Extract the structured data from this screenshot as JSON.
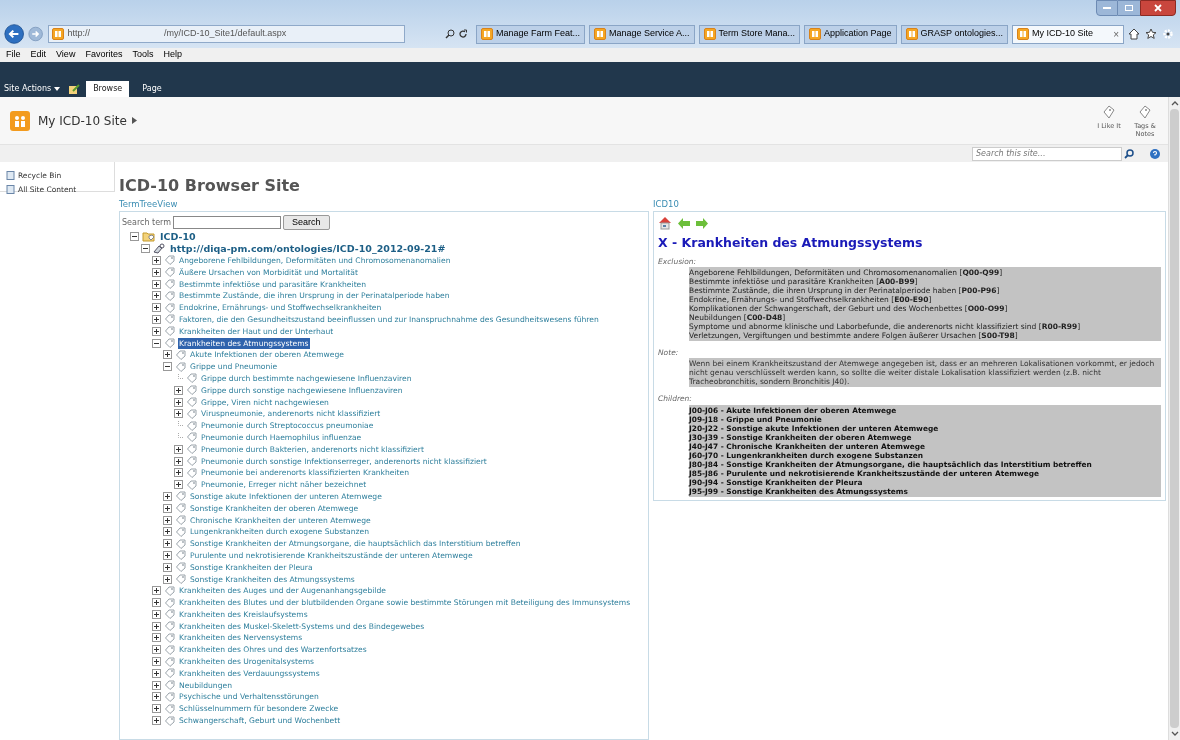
{
  "browser": {
    "address": {
      "scheme": "http://",
      "path": "/my/ICD-10_Site1/default.aspx"
    },
    "tabs": [
      {
        "label": "Manage Farm Feat...",
        "selected": false
      },
      {
        "label": "Manage Service A...",
        "selected": false
      },
      {
        "label": "Term Store Mana...",
        "selected": false
      },
      {
        "label": "Application Page",
        "selected": false
      },
      {
        "label": "GRASP ontologies...",
        "selected": false
      },
      {
        "label": "My ICD-10 Site",
        "selected": true
      }
    ],
    "close_tab": "×",
    "menu": [
      "File",
      "Edit",
      "View",
      "Favorites",
      "Tools",
      "Help"
    ]
  },
  "ribbon": {
    "site_actions": "Site Actions",
    "tabs": [
      {
        "label": "Browse",
        "selected": true
      },
      {
        "label": "Page",
        "selected": false
      }
    ],
    "breadcrumb": "My ICD-10 Site",
    "actions": [
      "I Like It",
      "Tags & Notes"
    ],
    "search": {
      "placeholder": "Search this site..."
    }
  },
  "left_nav": [
    "Recycle Bin",
    "All Site Content"
  ],
  "page_title": "ICD-10 Browser Site",
  "tree_panel": {
    "title": "TermTreeView",
    "search_label": "Search term",
    "search_button": "Search",
    "tree": [
      {
        "label": "ICD-10",
        "kind": "root",
        "expanded": true,
        "leaf": false,
        "selected": false,
        "children": [
          {
            "label": "http://diqa-pm.com/ontologies/ICD-10_2012-09-21#",
            "kind": "ontology",
            "expanded": true,
            "leaf": false,
            "selected": false,
            "children": [
              {
                "label": "Angeborene Fehlbildungen, Deformitäten und Chromosomenanomalien",
                "kind": "term",
                "expanded": false,
                "leaf": false,
                "selected": false
              },
              {
                "label": "Äußere Ursachen von Morbidität und Mortalität",
                "kind": "term",
                "expanded": false,
                "leaf": false,
                "selected": false
              },
              {
                "label": "Bestimmte infektiöse und parasitäre Krankheiten",
                "kind": "term",
                "expanded": false,
                "leaf": false,
                "selected": false
              },
              {
                "label": "Bestimmte Zustände, die ihren Ursprung in der Perinatalperiode haben",
                "kind": "term",
                "expanded": false,
                "leaf": false,
                "selected": false
              },
              {
                "label": "Endokrine, Ernährungs- und Stoffwechselkrankheiten",
                "kind": "term",
                "expanded": false,
                "leaf": false,
                "selected": false
              },
              {
                "label": "Faktoren, die den Gesundheitszustand beeinflussen und zur Inanspruchnahme des Gesundheitswesens führen",
                "kind": "term",
                "expanded": false,
                "leaf": false,
                "selected": false
              },
              {
                "label": "Krankheiten der Haut und der Unterhaut",
                "kind": "term",
                "expanded": false,
                "leaf": false,
                "selected": false
              },
              {
                "label": "Krankheiten des Atmungssystems",
                "kind": "term",
                "expanded": true,
                "leaf": false,
                "selected": true,
                "children": [
                  {
                    "label": "Akute Infektionen der oberen Atemwege",
                    "kind": "term",
                    "expanded": false,
                    "leaf": false,
                    "selected": false
                  },
                  {
                    "label": "Grippe und Pneumonie",
                    "kind": "term",
                    "expanded": true,
                    "leaf": false,
                    "selected": false,
                    "children": [
                      {
                        "label": "Grippe durch bestimmte nachgewiesene Influenzaviren",
                        "kind": "term",
                        "expanded": false,
                        "leaf": true,
                        "selected": false
                      },
                      {
                        "label": "Grippe durch sonstige nachgewiesene Influenzaviren",
                        "kind": "term",
                        "expanded": false,
                        "leaf": false,
                        "selected": false
                      },
                      {
                        "label": "Grippe, Viren nicht nachgewiesen",
                        "kind": "term",
                        "expanded": false,
                        "leaf": false,
                        "selected": false
                      },
                      {
                        "label": "Viruspneumonie, anderenorts nicht klassifiziert",
                        "kind": "term",
                        "expanded": false,
                        "leaf": false,
                        "selected": false
                      },
                      {
                        "label": "Pneumonie durch Streptococcus pneumoniae",
                        "kind": "term",
                        "expanded": false,
                        "leaf": true,
                        "selected": false
                      },
                      {
                        "label": "Pneumonie durch Haemophilus influenzae",
                        "kind": "term",
                        "expanded": false,
                        "leaf": true,
                        "selected": false
                      },
                      {
                        "label": "Pneumonie durch Bakterien, anderenorts nicht klassifiziert",
                        "kind": "term",
                        "expanded": false,
                        "leaf": false,
                        "selected": false
                      },
                      {
                        "label": "Pneumonie durch sonstige Infektionserreger, anderenorts nicht klassifiziert",
                        "kind": "term",
                        "expanded": false,
                        "leaf": false,
                        "selected": false
                      },
                      {
                        "label": "Pneumonie bei anderenorts klassifizierten Krankheiten",
                        "kind": "term",
                        "expanded": false,
                        "leaf": false,
                        "selected": false
                      },
                      {
                        "label": "Pneumonie, Erreger nicht näher bezeichnet",
                        "kind": "term",
                        "expanded": false,
                        "leaf": false,
                        "selected": false
                      }
                    ]
                  },
                  {
                    "label": "Sonstige akute Infektionen der unteren Atemwege",
                    "kind": "term",
                    "expanded": false,
                    "leaf": false,
                    "selected": false
                  },
                  {
                    "label": "Sonstige Krankheiten der oberen Atemwege",
                    "kind": "term",
                    "expanded": false,
                    "leaf": false,
                    "selected": false
                  },
                  {
                    "label": "Chronische Krankheiten der unteren Atemwege",
                    "kind": "term",
                    "expanded": false,
                    "leaf": false,
                    "selected": false
                  },
                  {
                    "label": "Lungenkrankheiten durch exogene Substanzen",
                    "kind": "term",
                    "expanded": false,
                    "leaf": false,
                    "selected": false
                  },
                  {
                    "label": "Sonstige Krankheiten der Atmungsorgane, die hauptsächlich das Interstitium betreffen",
                    "kind": "term",
                    "expanded": false,
                    "leaf": false,
                    "selected": false
                  },
                  {
                    "label": "Purulente und nekrotisierende Krankheitszustände der unteren Atemwege",
                    "kind": "term",
                    "expanded": false,
                    "leaf": false,
                    "selected": false
                  },
                  {
                    "label": "Sonstige Krankheiten der Pleura",
                    "kind": "term",
                    "expanded": false,
                    "leaf": false,
                    "selected": false
                  },
                  {
                    "label": "Sonstige Krankheiten des Atmungssystems",
                    "kind": "term",
                    "expanded": false,
                    "leaf": false,
                    "selected": false
                  }
                ]
              },
              {
                "label": "Krankheiten des Auges und der Augenanhangsgebilde",
                "kind": "term",
                "expanded": false,
                "leaf": false,
                "selected": false
              },
              {
                "label": "Krankheiten des Blutes und der blutbildenden Organe sowie bestimmte Störungen mit Beteiligung des Immunsystems",
                "kind": "term",
                "expanded": false,
                "leaf": false,
                "selected": false
              },
              {
                "label": "Krankheiten des Kreislaufsystems",
                "kind": "term",
                "expanded": false,
                "leaf": false,
                "selected": false
              },
              {
                "label": "Krankheiten des Muskel-Skelett-Systems und des Bindegewebes",
                "kind": "term",
                "expanded": false,
                "leaf": false,
                "selected": false
              },
              {
                "label": "Krankheiten des Nervensystems",
                "kind": "term",
                "expanded": false,
                "leaf": false,
                "selected": false
              },
              {
                "label": "Krankheiten des Ohres und des Warzenfortsatzes",
                "kind": "term",
                "expanded": false,
                "leaf": false,
                "selected": false
              },
              {
                "label": "Krankheiten des Urogenitalsystems",
                "kind": "term",
                "expanded": false,
                "leaf": false,
                "selected": false
              },
              {
                "label": "Krankheiten des Verdauungssystems",
                "kind": "term",
                "expanded": false,
                "leaf": false,
                "selected": false
              },
              {
                "label": "Neubildungen",
                "kind": "term",
                "expanded": false,
                "leaf": false,
                "selected": false
              },
              {
                "label": "Psychische und Verhaltensstörungen",
                "kind": "term",
                "expanded": false,
                "leaf": false,
                "selected": false
              },
              {
                "label": "Schlüsselnummern für besondere Zwecke",
                "kind": "term",
                "expanded": false,
                "leaf": false,
                "selected": false
              },
              {
                "label": "Schwangerschaft, Geburt und Wochenbett",
                "kind": "term",
                "expanded": false,
                "leaf": false,
                "selected": false
              }
            ]
          }
        ]
      }
    ]
  },
  "detail_panel": {
    "title": "ICD10",
    "heading": "X - Krankheiten des Atmungssystems",
    "exclusion_label": "Exclusion:",
    "exclusions": [
      "Angeborene Fehlbildungen, Deformitäten und Chromosomenanomalien [**Q00-Q99**]",
      "Bestimmte infektiöse und parasitäre Krankheiten [**A00-B99**]",
      "Bestimmte Zustände, die ihren Ursprung in der Perinatalperiode haben [**P00-P96**]",
      "Endokrine, Ernährungs- und Stoffwechselkrankheiten [**E00-E90**]",
      "Komplikationen der Schwangerschaft, der Geburt und des Wochenbettes [**O00-O99**]",
      "Neubildungen [**C00-D48**]",
      "Symptome und abnorme klinische und Laborbefunde, die anderenorts nicht klassifiziert sind [**R00-R99**]",
      "Verletzungen, Vergiftungen und bestimmte andere Folgen äußerer Ursachen [**S00-T98**]"
    ],
    "note_label": "Note:",
    "note": "Wenn bei einem Krankheitszustand der Atemwege angegeben ist, dass er an mehreren Lokalisationen vorkommt, er jedoch nicht genau verschlüsselt werden kann, so sollte die weiter distale Lokalisation klassifiziert werden (z.B. nicht Tracheobronchitis, sondern Bronchitis J40).",
    "children_label": "Children:",
    "children": [
      "J00-J06 - Akute Infektionen der oberen Atemwege",
      "J09-J18 - Grippe und Pneumonie",
      "J20-J22 - Sonstige akute Infektionen der unteren Atemwege",
      "J30-J39 - Sonstige Krankheiten der oberen Atemwege",
      "J40-J47 - Chronische Krankheiten der unteren Atemwege",
      "J60-J70 - Lungenkrankheiten durch exogene Substanzen",
      "J80-J84 - Sonstige Krankheiten der Atmungsorgane, die hauptsächlich das Interstitium betreffen",
      "J85-J86 - Purulente und nekrotisierende Krankheitszustände der unteren Atemwege",
      "J90-J94 - Sonstige Krankheiten der Pleura",
      "J95-J99 - Sonstige Krankheiten des Atmungssystems"
    ]
  }
}
